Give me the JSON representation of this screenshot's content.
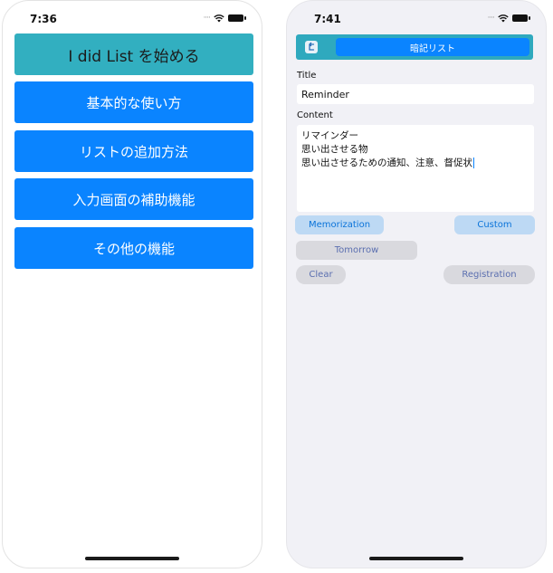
{
  "left_screen": {
    "status_time": "7:36",
    "start_label": "I did List を始める",
    "menu_items": [
      {
        "label": "基本的な使い方"
      },
      {
        "label": "リストの追加方法"
      },
      {
        "label": "入力画面の補助機能"
      },
      {
        "label": "その他の機能"
      }
    ]
  },
  "right_screen": {
    "status_time": "7:41",
    "nav_title": "暗記リスト",
    "title_label": "Title",
    "title_value": "Reminder",
    "content_label": "Content",
    "content_lines": [
      "リマインダー",
      "思い出させる物",
      "思い出させるための通知、注意、督促状"
    ],
    "buttons": {
      "memorization": "Memorization",
      "custom": "Custom",
      "tomorrow": "Tomorrow",
      "clear": "Clear",
      "registration": "Registration"
    }
  },
  "colors": {
    "accent_blue": "#0a84ff",
    "teal": "#32afc0",
    "light_blue_button": "#bdd9f4",
    "grey_button": "#d9d9de",
    "right_background": "#f1f1f6"
  },
  "icons": {
    "back": "back-arrow-icon",
    "wifi": "wifi-icon",
    "battery": "battery-icon",
    "signal": "signal-dots-icon"
  }
}
